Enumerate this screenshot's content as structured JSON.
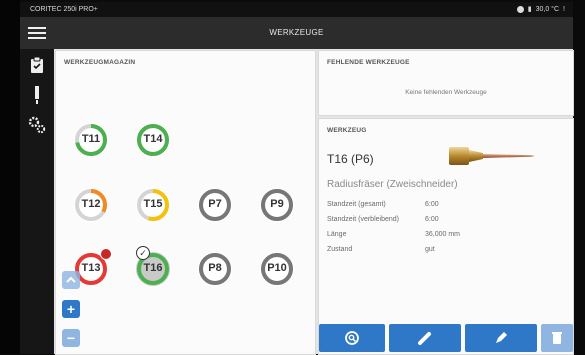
{
  "statusbar": {
    "device": "CORITEC 250i PRO+",
    "temp": "30,0 °C"
  },
  "appbar": {
    "title": "WERKZEUGE"
  },
  "magazine": {
    "title": "WERKZEUGMAGAZIN",
    "tools": [
      {
        "label": "T11",
        "ring_color": "#4caf50",
        "fill": 0.72,
        "selected": false
      },
      {
        "label": "T14",
        "ring_color": "#4caf50",
        "fill": 1.0,
        "selected": false
      },
      {
        "label": "T12",
        "ring_color": "#f08a24",
        "fill": 0.33,
        "selected": false
      },
      {
        "label": "T15",
        "ring_color": "#f4c20d",
        "fill": 0.55,
        "selected": false
      },
      {
        "label": "P7",
        "ring_color": "#777777",
        "fill": 1.0,
        "selected": false
      },
      {
        "label": "P9",
        "ring_color": "#777777",
        "fill": 1.0,
        "selected": false
      },
      {
        "label": "T13",
        "ring_color": "#e53935",
        "fill": 1.0,
        "selected": false
      },
      {
        "label": "T16",
        "ring_color": "#4caf50",
        "fill": 1.0,
        "selected": true
      },
      {
        "label": "P8",
        "ring_color": "#777777",
        "fill": 1.0,
        "selected": false
      },
      {
        "label": "P10",
        "ring_color": "#777777",
        "fill": 1.0,
        "selected": false
      }
    ],
    "add_label": "+",
    "remove_label": "−"
  },
  "missing": {
    "title": "FEHLENDE WERKZEUGE",
    "empty_text": "Keine fehlenden Werkzeuge"
  },
  "tool": {
    "title": "WERKZEUG",
    "name": "T16 (P6)",
    "type": "Radiusfräser (Zweischneider)",
    "rows": [
      {
        "key": "Standzeit (gesamt)",
        "value": "6:00"
      },
      {
        "key": "Standzeit (verbleibend)",
        "value": "6:00"
      },
      {
        "key": "Länge",
        "value": "36,000 mm"
      },
      {
        "key": "Zustand",
        "value": "gut"
      }
    ]
  },
  "colors": {
    "accent": "#2f78c8",
    "appbar": "#2c2c2c",
    "nav": "#161616"
  }
}
